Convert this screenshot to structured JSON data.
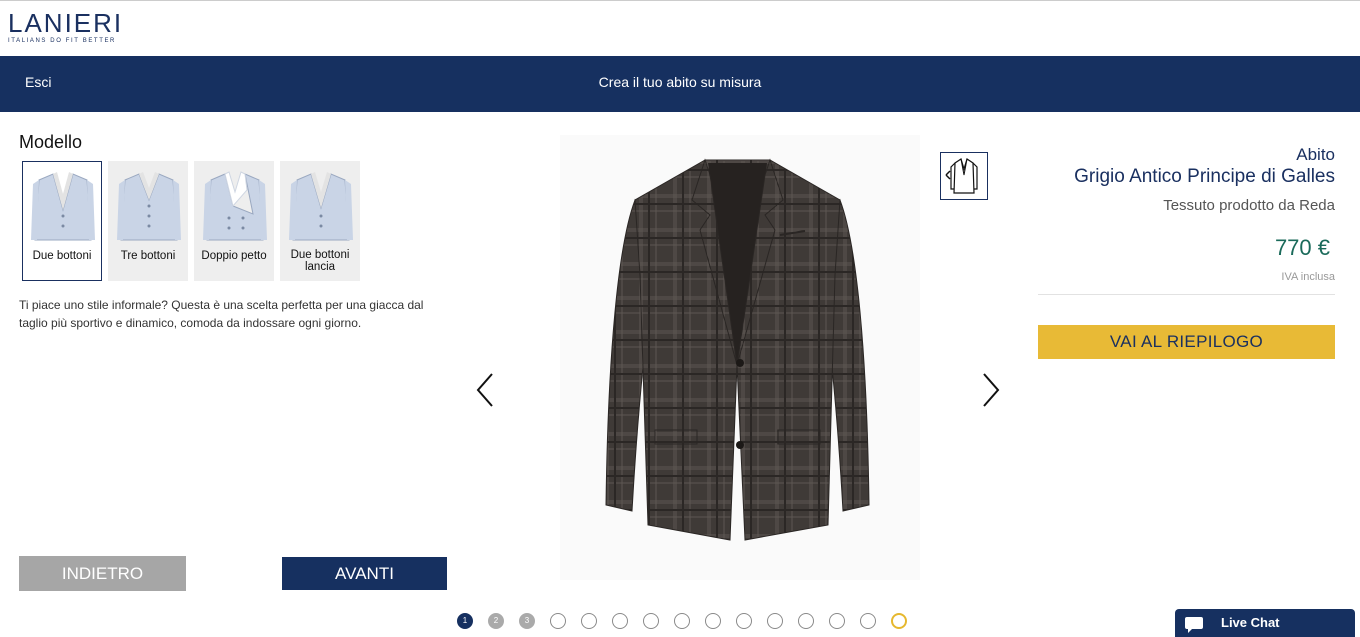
{
  "header": {
    "logo_word": "LANIERI",
    "logo_tagline": "ITALIANS DO FIT BETTER"
  },
  "navbar": {
    "exit_label": "Esci",
    "title": "Crea il tuo abito su misura"
  },
  "configurator": {
    "section_title": "Modello",
    "models": [
      {
        "label": "Due bottoni",
        "selected": true
      },
      {
        "label": "Tre bottoni",
        "selected": false
      },
      {
        "label": "Doppio petto",
        "selected": false
      },
      {
        "label": "Due bottoni lancia",
        "selected": false
      }
    ],
    "description": "Ti piace uno stile informale? Questa è una scelta perfetta per una giacca dal taglio più sportivo e dinamico, comoda da indossare ogni giorno.",
    "back_label": "INDIETRO",
    "next_label": "AVANTI"
  },
  "preview": {
    "jacket_icon": "jacket-preview",
    "prev_icon": "chevron-left-icon",
    "next_icon": "chevron-right-icon",
    "view_toggle_icon": "jacket-back-view-icon"
  },
  "steps": {
    "items": [
      "1",
      "2",
      "3",
      "",
      "",
      "",
      "",
      "",
      "",
      "",
      "",
      "",
      "",
      "",
      ""
    ],
    "current": 1,
    "completed": [
      2,
      3
    ]
  },
  "product": {
    "category": "Abito",
    "name": "Grigio Antico Principe di Galles",
    "fabric": "Tessuto prodotto da Reda",
    "price": "770 €",
    "vat_note": "IVA inclusa",
    "summary_label": "VAI AL RIEPILOGO"
  },
  "livechat": {
    "label": "Live Chat"
  },
  "colors": {
    "navy": "#163060",
    "gold": "#e8ba36",
    "price_green": "#1a6a5a",
    "grey_button": "#a6a6a6"
  }
}
